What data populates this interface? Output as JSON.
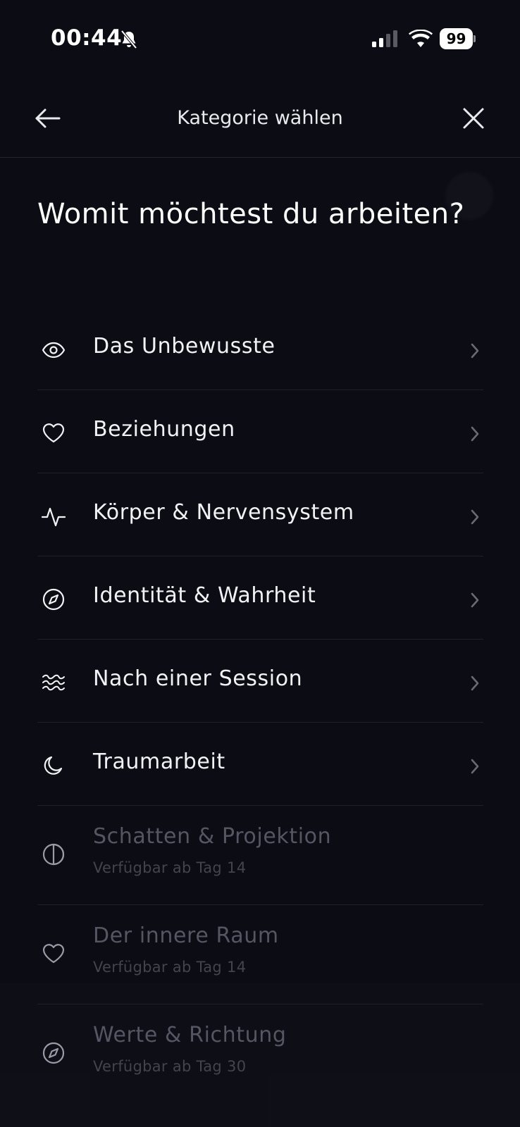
{
  "status_bar": {
    "time": "00:44",
    "battery": "99"
  },
  "header": {
    "title": "Kategorie wählen"
  },
  "heading": "Womit möchtest du arbeiten?",
  "categories": [
    {
      "label": "Das Unbewusste",
      "icon": "eye-icon"
    },
    {
      "label": "Beziehungen",
      "icon": "heart-icon"
    },
    {
      "label": "Körper & Nervensystem",
      "icon": "pulse-icon"
    },
    {
      "label": "Identität & Wahrheit",
      "icon": "compass-icon"
    },
    {
      "label": "Nach einer Session",
      "icon": "waves-icon"
    },
    {
      "label": "Traumarbeit",
      "icon": "moon-icon"
    }
  ],
  "locked_categories": [
    {
      "label": "Schatten & Projektion",
      "sub": "Verfügbar ab Tag 14",
      "icon": "half-circle-icon"
    },
    {
      "label": "Der innere Raum",
      "sub": "Verfügbar ab Tag 14",
      "icon": "heart-icon"
    },
    {
      "label": "Werte & Richtung",
      "sub": "Verfügbar ab Tag 30",
      "icon": "compass-icon"
    }
  ],
  "colors": {
    "background": "#0c0c14",
    "text": "#f2f2f5",
    "locked_text": "#555563",
    "divider": "#20202a"
  }
}
